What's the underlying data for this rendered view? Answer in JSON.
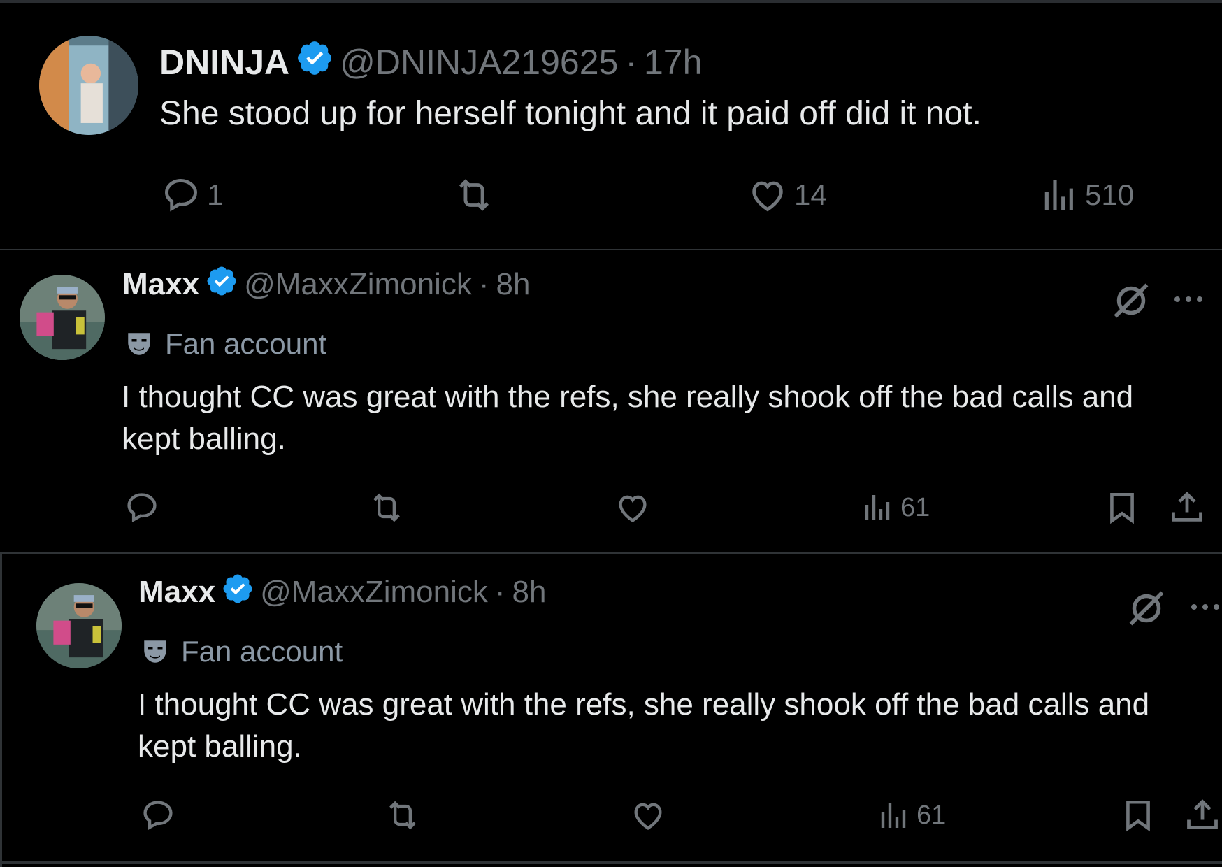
{
  "tweet1": {
    "name": "DNINJA",
    "handle": "@DNINJA219625",
    "separator": "·",
    "time": "17h",
    "text": "She stood up for herself tonight and it paid off did it not.",
    "replies": "1",
    "reposts": "",
    "likes": "14",
    "views": "510"
  },
  "tweet2": {
    "name": "Maxx",
    "handle": "@MaxxZimonick",
    "separator": "·",
    "time": "8h",
    "label": "Fan account",
    "text_line1": "I thought CC was great  with the refs,  she really shook off the bad calls and",
    "text_line2": "kept balling.",
    "views": "61"
  },
  "tweet3": {
    "name": "Maxx",
    "handle": "@MaxxZimonick",
    "separator": "·",
    "time": "8h",
    "label": "Fan account",
    "text_line1": "I thought CC was great  with the refs,  she really shook off the bad calls and",
    "text_line2": "kept balling.",
    "views": "61"
  },
  "colors": {
    "background": "#000000",
    "text": "#e7e9ea",
    "muted": "#71767b",
    "verified": "#1d9bf0",
    "divider": "#2f3336"
  },
  "icons": [
    "reply-icon",
    "repost-icon",
    "like-icon",
    "views-icon",
    "bookmark-icon",
    "share-icon",
    "verified-badge-icon",
    "grok-icon",
    "more-icon",
    "mask-icon"
  ]
}
